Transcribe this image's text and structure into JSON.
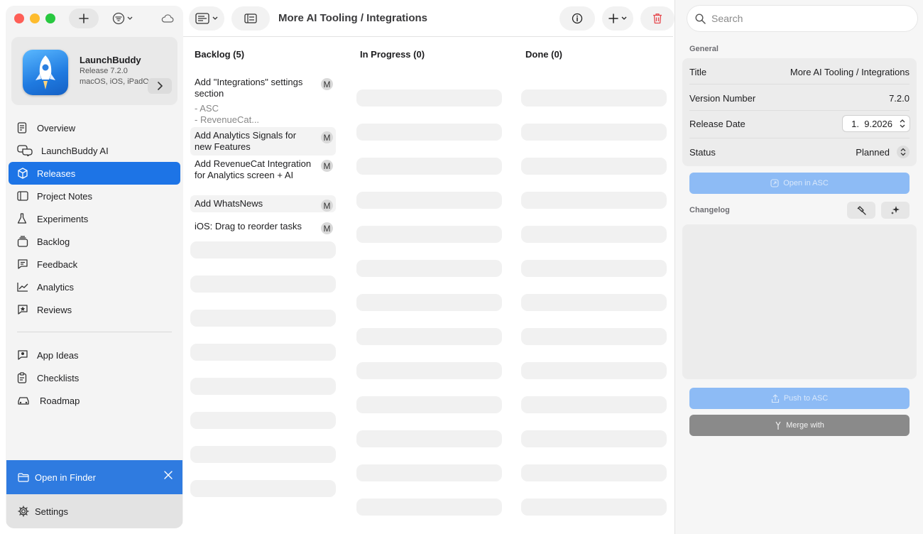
{
  "sidebar": {
    "app": {
      "name": "LaunchBuddy",
      "release": "Release 7.2.0",
      "platforms": "macOS, iOS, iPadOS"
    },
    "items": [
      {
        "label": "Overview",
        "icon": "document-icon"
      },
      {
        "label": "LaunchBuddy AI",
        "icon": "chat-bubbles-icon"
      },
      {
        "label": "Releases",
        "icon": "cube-icon",
        "active": true
      },
      {
        "label": "Project Notes",
        "icon": "notes-icon"
      },
      {
        "label": "Experiments",
        "icon": "flask-icon"
      },
      {
        "label": "Backlog",
        "icon": "tray-icon"
      },
      {
        "label": "Feedback",
        "icon": "feedback-icon"
      },
      {
        "label": "Analytics",
        "icon": "chart-line-icon"
      },
      {
        "label": "Reviews",
        "icon": "star-bubble-icon"
      }
    ],
    "items2": [
      {
        "label": "App Ideas",
        "icon": "lightbulb-icon"
      },
      {
        "label": "Checklists",
        "icon": "clipboard-icon"
      },
      {
        "label": "Roadmap",
        "icon": "car-icon"
      }
    ],
    "finder_label": "Open in Finder",
    "settings_label": "Settings"
  },
  "toolbar": {
    "title": "More AI Tooling / Integrations"
  },
  "board": {
    "columns": [
      {
        "title": "Backlog (5)"
      },
      {
        "title": "In Progress (0)"
      },
      {
        "title": "Done (0)"
      }
    ],
    "tasks": [
      {
        "title": "Add \"Integrations\" settings section",
        "sub": [
          "- ASC",
          "- RevenueCat..."
        ],
        "badge": "M"
      },
      {
        "title": "Add Analytics Signals for new Features",
        "sub": [],
        "badge": "M"
      },
      {
        "title": "Add RevenueCat Integration for Analytics screen + AI",
        "sub": [],
        "badge": "M"
      },
      {
        "title": "Add WhatsNews",
        "sub": [],
        "badge": "M"
      },
      {
        "title": "iOS: Drag to reorder tasks",
        "sub": [],
        "badge": "M"
      }
    ]
  },
  "inspector": {
    "search_placeholder": "Search",
    "general_label": "General",
    "fields": {
      "title_label": "Title",
      "title_value": "More AI Tooling / Integrations",
      "version_label": "Version Number",
      "version_value": "7.2.0",
      "date_label": "Release Date",
      "date_value": "1.  9.2026",
      "status_label": "Status",
      "status_value": "Planned"
    },
    "open_asc_label": "Open in ASC",
    "changelog_label": "Changelog",
    "push_asc_label": "Push to ASC",
    "merge_label": "Merge with"
  },
  "colors": {
    "accent": "#1d74e6",
    "finder_bar": "#2f7be0",
    "disabled_button": "#8dbbf5",
    "trash": "#e5484d"
  }
}
